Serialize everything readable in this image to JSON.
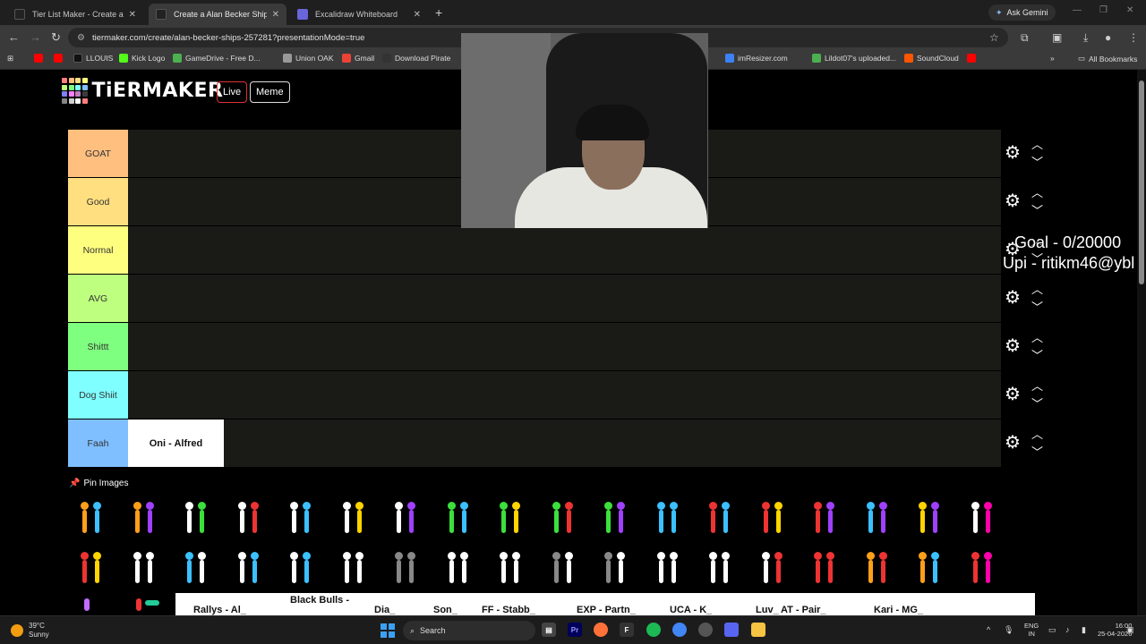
{
  "browser": {
    "tabs": [
      {
        "title": "Tier List Maker - Create a Tier L",
        "close": "✕",
        "favicon_color": "#222"
      },
      {
        "title": "Create a Alan Becker Ships Tier",
        "close": "✕",
        "favicon_color": "#222"
      },
      {
        "title": "Excalidraw Whiteboard",
        "close": "✕",
        "favicon_color": "#6965db"
      }
    ],
    "new_tab": "+",
    "ask_gemini": "Ask Gemini",
    "url": "tiermaker.com/create/alan-becker-ships-257281?presentationMode=true",
    "bookmarks": [
      {
        "label": "",
        "color": "#ff0000"
      },
      {
        "label": "",
        "color": "#ff0000"
      },
      {
        "label": "LLOUIS",
        "color": "#111"
      },
      {
        "label": "Kick Logo",
        "color": "#53fc18"
      },
      {
        "label": "GameDrive - Free D...",
        "color": "#4caf50"
      },
      {
        "label": "Union OAK",
        "color": "#999"
      },
      {
        "label": "Gmail",
        "color": "#ea4335"
      },
      {
        "label": "Download Pirate",
        "color": "#333"
      },
      {
        "label": "imResizer.com",
        "color": "#3b82f6"
      },
      {
        "label": "Lildot07's uploaded...",
        "color": "#4caf50"
      },
      {
        "label": "SoundCloud",
        "color": "#ff5500"
      },
      {
        "label": "",
        "color": "#ff0000"
      }
    ],
    "all_bookmarks": "All Bookmarks"
  },
  "site": {
    "logo": "TiERMAKER",
    "logo_colors": [
      "#ff7f7f",
      "#ffbf7f",
      "#ffdf7f",
      "#ffff7f",
      "#bfff7f",
      "#7fff7f",
      "#7fffff",
      "#7fbfff",
      "#7f7fff",
      "#ff7fff",
      "#bf7fbf",
      "#3b3b3b",
      "#858585",
      "#cfcfcf",
      "#f7f7f7",
      "#ff7f7f"
    ],
    "live_label": "Live",
    "meme_label": "Meme"
  },
  "tiers": [
    {
      "label": "GOAT",
      "color": "#ffbf7f",
      "items": []
    },
    {
      "label": "Good",
      "color": "#ffdf7f",
      "items": []
    },
    {
      "label": "Normal",
      "color": "#ffff7f",
      "items": []
    },
    {
      "label": "AVG",
      "color": "#bfff7f",
      "items": []
    },
    {
      "label": "Shittt",
      "color": "#7fff7f",
      "items": []
    },
    {
      "label": "Dog Shiit",
      "color": "#7fffff",
      "items": []
    },
    {
      "label": "Faah",
      "color": "#7fbfff",
      "items": [
        "Oni - Alfred"
      ]
    }
  ],
  "pin_images": "Pin Images",
  "overlay": {
    "goal": "Goal - 0/20000",
    "upi": "Upi - ritikm46@ybl"
  },
  "bottom_strip": [
    "Rallys - Al_",
    "Black Bulls -",
    "Dia_",
    "Son_",
    "FF - Stabb_",
    "EXP - Partn_",
    "UCA - K_",
    "Luv_",
    "AT - Pair_",
    "Kari - MG_"
  ],
  "taskbar": {
    "temp": "39°C",
    "condition": "Sunny",
    "search": "Search",
    "lang1": "ENG",
    "lang2": "IN",
    "time": "16:00",
    "date": "25-04-2026"
  }
}
